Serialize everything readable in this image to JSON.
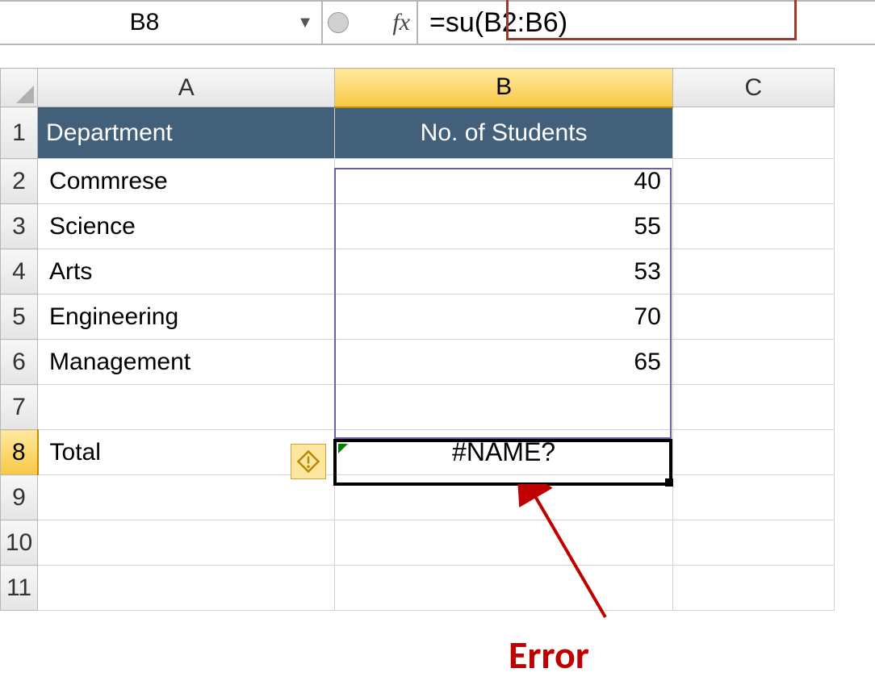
{
  "formula_bar": {
    "cell_ref": "B8",
    "fx_label": "fx",
    "formula": "=su(B2:B6)"
  },
  "columns": {
    "A": "A",
    "B": "B",
    "C": "C"
  },
  "rows": [
    "1",
    "2",
    "3",
    "4",
    "5",
    "6",
    "7",
    "8",
    "9",
    "10",
    "11"
  ],
  "header": {
    "dept": "Department",
    "num": "No. of Students"
  },
  "data": [
    {
      "dept": "Commrese",
      "num": "40"
    },
    {
      "dept": "Science",
      "num": "55"
    },
    {
      "dept": "Arts",
      "num": "53"
    },
    {
      "dept": "Engineering",
      "num": "70"
    },
    {
      "dept": "Management",
      "num": "65"
    }
  ],
  "total_row": {
    "label": "Total",
    "value": "#NAME?"
  },
  "annotation": {
    "label": "Error"
  },
  "chart_data": {
    "type": "table",
    "title": "No. of Students",
    "categories": [
      "Commrese",
      "Science",
      "Arts",
      "Engineering",
      "Management"
    ],
    "values": [
      40,
      55,
      53,
      70,
      65
    ]
  }
}
